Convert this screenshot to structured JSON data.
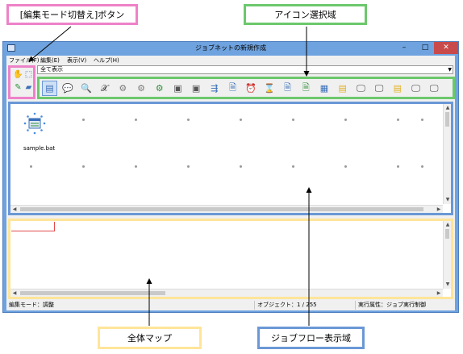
{
  "callouts": {
    "mode_button": "[編集モード切替え]ボタン",
    "icon_area": "アイコン選択域",
    "overall_map": "全体マップ",
    "job_flow_area": "ジョブフロー表示域"
  },
  "window": {
    "title": "ジョブネットの新規作成",
    "minimize": "–",
    "maximize": "□",
    "close": "✕"
  },
  "menu": [
    {
      "label": "ファイル(F)"
    },
    {
      "label": "編集(E)"
    },
    {
      "label": "表示(V)"
    },
    {
      "label": "ヘルプ(H)"
    }
  ],
  "view_select": {
    "value": "全て表示"
  },
  "mode_buttons": [
    {
      "icon": "hand-icon",
      "glyph": "✋"
    },
    {
      "icon": "select-icon",
      "glyph": "⬚"
    },
    {
      "icon": "pencil-icon",
      "glyph": "✎"
    },
    {
      "icon": "eraser-icon",
      "glyph": "▰"
    }
  ],
  "palette_icons": [
    {
      "icon": "job-icon",
      "glyph": "▤"
    },
    {
      "icon": "message-icon",
      "glyph": "💬"
    },
    {
      "icon": "file-search-icon",
      "glyph": "🔍"
    },
    {
      "icon": "formula-icon",
      "glyph": "𝒳"
    },
    {
      "icon": "gear-icon",
      "glyph": "⚙"
    },
    {
      "icon": "gear-stop-icon",
      "glyph": "⚙"
    },
    {
      "icon": "gear-check-icon",
      "glyph": "⚙"
    },
    {
      "icon": "printer-icon",
      "glyph": "▣"
    },
    {
      "icon": "printer-lock-icon",
      "glyph": "▣"
    },
    {
      "icon": "transfer-icon",
      "glyph": "⇶"
    },
    {
      "icon": "file-clock-icon",
      "glyph": "🗎"
    },
    {
      "icon": "alarm-clock-icon",
      "glyph": "⏰"
    },
    {
      "icon": "hourglass-icon",
      "glyph": "⌛"
    },
    {
      "icon": "document-icon",
      "glyph": "🗎"
    },
    {
      "icon": "document-arrow-icon",
      "glyph": "🗎"
    },
    {
      "icon": "calendar-icon",
      "glyph": "▦"
    },
    {
      "icon": "note-yellow-icon",
      "glyph": "▤"
    },
    {
      "icon": "monitor-chat-icon",
      "glyph": "🖵"
    },
    {
      "icon": "monitor-cancel-icon",
      "glyph": "🖵"
    },
    {
      "icon": "note-cancel-icon",
      "glyph": "▤"
    },
    {
      "icon": "monitor-stop-icon",
      "glyph": "🖵"
    },
    {
      "icon": "monitor-arrow-icon",
      "glyph": "🖵"
    }
  ],
  "flow": {
    "job": {
      "label": "sample.bat",
      "icon": "batch-job-icon"
    }
  },
  "status": {
    "mode": "編集モード：調整",
    "objects": "オブジェクト：1 / 255",
    "attribute": "実行属性：ジョブ実行制御"
  },
  "colors": {
    "pink": "#ee82c8",
    "green": "#6cc86c",
    "yellow": "#ffe59a",
    "blue": "#6a98d6",
    "window_frame": "#6fa3df",
    "close_button": "#c94a4a"
  }
}
